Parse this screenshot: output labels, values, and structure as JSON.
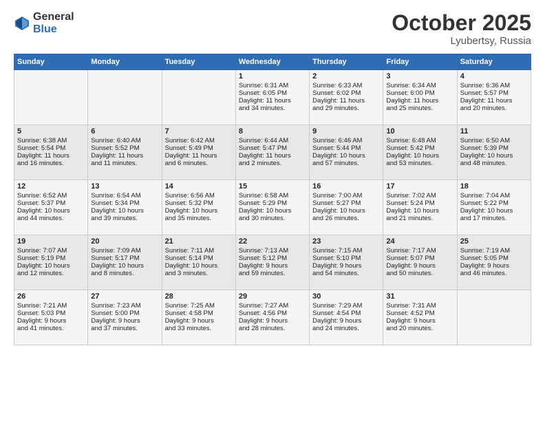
{
  "header": {
    "logo_general": "General",
    "logo_blue": "Blue",
    "month": "October 2025",
    "location": "Lyubertsy, Russia"
  },
  "weekdays": [
    "Sunday",
    "Monday",
    "Tuesday",
    "Wednesday",
    "Thursday",
    "Friday",
    "Saturday"
  ],
  "weeks": [
    [
      {
        "day": "",
        "content": ""
      },
      {
        "day": "",
        "content": ""
      },
      {
        "day": "",
        "content": ""
      },
      {
        "day": "1",
        "content": "Sunrise: 6:31 AM\nSunset: 6:05 PM\nDaylight: 11 hours\nand 34 minutes."
      },
      {
        "day": "2",
        "content": "Sunrise: 6:33 AM\nSunset: 6:02 PM\nDaylight: 11 hours\nand 29 minutes."
      },
      {
        "day": "3",
        "content": "Sunrise: 6:34 AM\nSunset: 6:00 PM\nDaylight: 11 hours\nand 25 minutes."
      },
      {
        "day": "4",
        "content": "Sunrise: 6:36 AM\nSunset: 5:57 PM\nDaylight: 11 hours\nand 20 minutes."
      }
    ],
    [
      {
        "day": "5",
        "content": "Sunrise: 6:38 AM\nSunset: 5:54 PM\nDaylight: 11 hours\nand 16 minutes."
      },
      {
        "day": "6",
        "content": "Sunrise: 6:40 AM\nSunset: 5:52 PM\nDaylight: 11 hours\nand 11 minutes."
      },
      {
        "day": "7",
        "content": "Sunrise: 6:42 AM\nSunset: 5:49 PM\nDaylight: 11 hours\nand 6 minutes."
      },
      {
        "day": "8",
        "content": "Sunrise: 6:44 AM\nSunset: 5:47 PM\nDaylight: 11 hours\nand 2 minutes."
      },
      {
        "day": "9",
        "content": "Sunrise: 6:46 AM\nSunset: 5:44 PM\nDaylight: 10 hours\nand 57 minutes."
      },
      {
        "day": "10",
        "content": "Sunrise: 6:48 AM\nSunset: 5:42 PM\nDaylight: 10 hours\nand 53 minutes."
      },
      {
        "day": "11",
        "content": "Sunrise: 6:50 AM\nSunset: 5:39 PM\nDaylight: 10 hours\nand 48 minutes."
      }
    ],
    [
      {
        "day": "12",
        "content": "Sunrise: 6:52 AM\nSunset: 5:37 PM\nDaylight: 10 hours\nand 44 minutes."
      },
      {
        "day": "13",
        "content": "Sunrise: 6:54 AM\nSunset: 5:34 PM\nDaylight: 10 hours\nand 39 minutes."
      },
      {
        "day": "14",
        "content": "Sunrise: 6:56 AM\nSunset: 5:32 PM\nDaylight: 10 hours\nand 35 minutes."
      },
      {
        "day": "15",
        "content": "Sunrise: 6:58 AM\nSunset: 5:29 PM\nDaylight: 10 hours\nand 30 minutes."
      },
      {
        "day": "16",
        "content": "Sunrise: 7:00 AM\nSunset: 5:27 PM\nDaylight: 10 hours\nand 26 minutes."
      },
      {
        "day": "17",
        "content": "Sunrise: 7:02 AM\nSunset: 5:24 PM\nDaylight: 10 hours\nand 21 minutes."
      },
      {
        "day": "18",
        "content": "Sunrise: 7:04 AM\nSunset: 5:22 PM\nDaylight: 10 hours\nand 17 minutes."
      }
    ],
    [
      {
        "day": "19",
        "content": "Sunrise: 7:07 AM\nSunset: 5:19 PM\nDaylight: 10 hours\nand 12 minutes."
      },
      {
        "day": "20",
        "content": "Sunrise: 7:09 AM\nSunset: 5:17 PM\nDaylight: 10 hours\nand 8 minutes."
      },
      {
        "day": "21",
        "content": "Sunrise: 7:11 AM\nSunset: 5:14 PM\nDaylight: 10 hours\nand 3 minutes."
      },
      {
        "day": "22",
        "content": "Sunrise: 7:13 AM\nSunset: 5:12 PM\nDaylight: 9 hours\nand 59 minutes."
      },
      {
        "day": "23",
        "content": "Sunrise: 7:15 AM\nSunset: 5:10 PM\nDaylight: 9 hours\nand 54 minutes."
      },
      {
        "day": "24",
        "content": "Sunrise: 7:17 AM\nSunset: 5:07 PM\nDaylight: 9 hours\nand 50 minutes."
      },
      {
        "day": "25",
        "content": "Sunrise: 7:19 AM\nSunset: 5:05 PM\nDaylight: 9 hours\nand 46 minutes."
      }
    ],
    [
      {
        "day": "26",
        "content": "Sunrise: 7:21 AM\nSunset: 5:03 PM\nDaylight: 9 hours\nand 41 minutes."
      },
      {
        "day": "27",
        "content": "Sunrise: 7:23 AM\nSunset: 5:00 PM\nDaylight: 9 hours\nand 37 minutes."
      },
      {
        "day": "28",
        "content": "Sunrise: 7:25 AM\nSunset: 4:58 PM\nDaylight: 9 hours\nand 33 minutes."
      },
      {
        "day": "29",
        "content": "Sunrise: 7:27 AM\nSunset: 4:56 PM\nDaylight: 9 hours\nand 28 minutes."
      },
      {
        "day": "30",
        "content": "Sunrise: 7:29 AM\nSunset: 4:54 PM\nDaylight: 9 hours\nand 24 minutes."
      },
      {
        "day": "31",
        "content": "Sunrise: 7:31 AM\nSunset: 4:52 PM\nDaylight: 9 hours\nand 20 minutes."
      },
      {
        "day": "",
        "content": ""
      }
    ]
  ]
}
